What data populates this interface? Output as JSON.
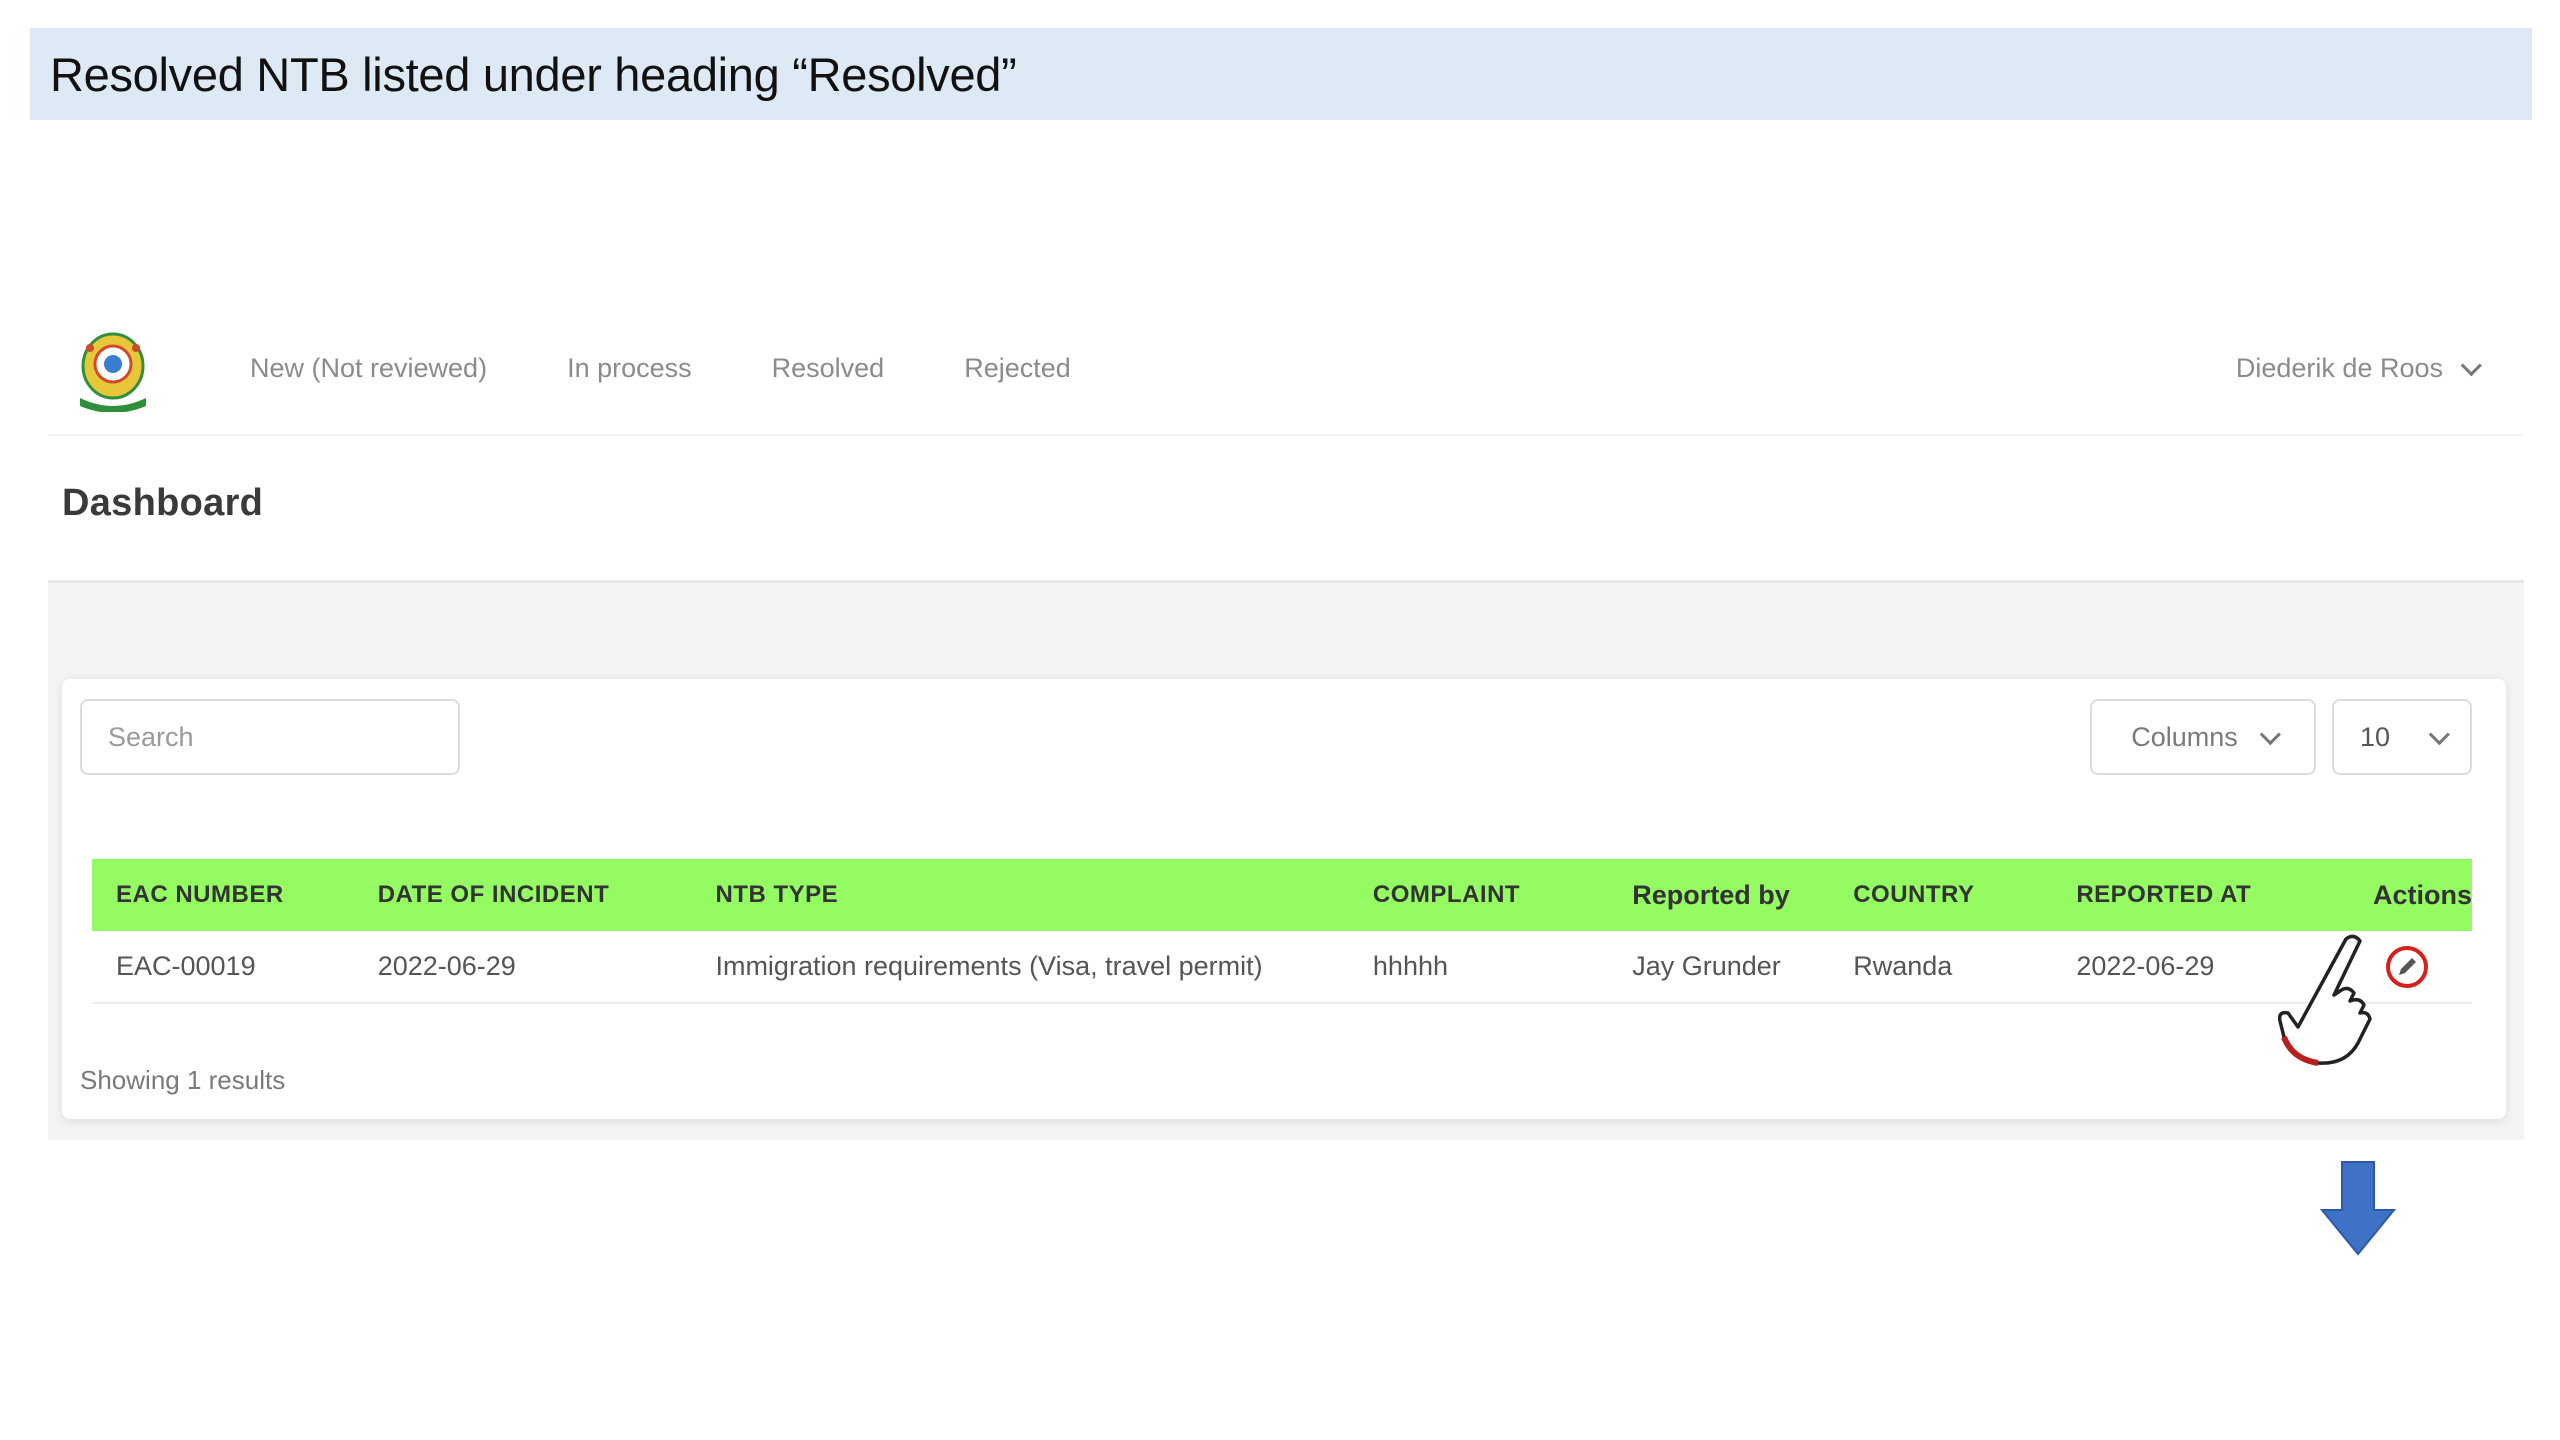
{
  "caption": {
    "text": "Resolved NTB listed under heading “Resolved”"
  },
  "navbar": {
    "logo_icon": "eac-emblem-icon",
    "links": [
      {
        "label": "New (Not reviewed)"
      },
      {
        "label": "In process"
      },
      {
        "label": "Resolved"
      },
      {
        "label": "Rejected"
      }
    ],
    "user": {
      "name": "Diederik de Roos",
      "icon": "chevron-down-icon"
    }
  },
  "page": {
    "title": "Dashboard"
  },
  "toolbar": {
    "search_placeholder": "Search",
    "columns_label": "Columns",
    "per_page_value": "10"
  },
  "table": {
    "header_color": "#94fc62",
    "headers": [
      "EAC NUMBER",
      "DATE OF INCIDENT",
      "NTB TYPE",
      "COMPLAINT",
      "Reported by",
      "COUNTRY",
      "REPORTED AT",
      "Actions"
    ],
    "rows": [
      {
        "eac_number": "EAC-00019",
        "date_of_incident": "2022-06-29",
        "ntb_type": "Immigration requirements (Visa, travel permit)",
        "complaint": "hhhhh",
        "reported_by": "Jay Grunder",
        "country": "Rwanda",
        "reported_at": "2022-06-29",
        "action_icon": "edit-pencil-icon"
      }
    ]
  },
  "footer": {
    "showing_text": "Showing 1 results"
  },
  "annotations": {
    "highlight_color": "#d62020",
    "arrow_color": "#3f72c4",
    "pointer_icon": "hand-pointer-icon",
    "arrow_icon": "arrow-down-icon"
  }
}
